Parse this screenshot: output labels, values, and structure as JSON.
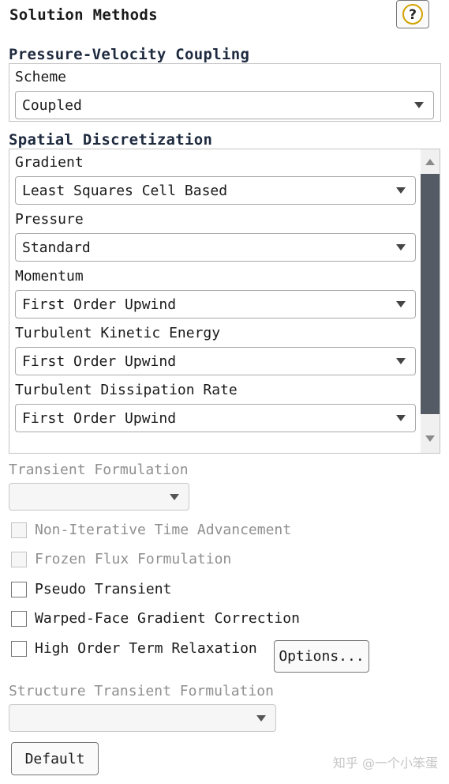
{
  "panel_title": "Solution Methods",
  "help_button_label": "?",
  "pressure_velocity": {
    "section_title": "Pressure-Velocity Coupling",
    "scheme_label": "Scheme",
    "scheme_value": "Coupled"
  },
  "spatial": {
    "section_title": "Spatial Discretization",
    "fields": [
      {
        "label": "Gradient",
        "value": "Least Squares Cell Based"
      },
      {
        "label": "Pressure",
        "value": "Standard"
      },
      {
        "label": "Momentum",
        "value": "First Order Upwind"
      },
      {
        "label": "Turbulent Kinetic Energy",
        "value": "First Order Upwind"
      },
      {
        "label": "Turbulent Dissipation Rate",
        "value": "First Order Upwind"
      }
    ]
  },
  "transient": {
    "label": "Transient Formulation",
    "value": ""
  },
  "checkboxes": [
    {
      "label": "Non-Iterative Time Advancement",
      "enabled": false,
      "checked": false
    },
    {
      "label": "Frozen Flux Formulation",
      "enabled": false,
      "checked": false
    },
    {
      "label": "Pseudo Transient",
      "enabled": true,
      "checked": false
    },
    {
      "label": "Warped-Face Gradient Correction",
      "enabled": true,
      "checked": false
    },
    {
      "label": "High Order Term Relaxation",
      "enabled": true,
      "checked": false
    }
  ],
  "options_button": "Options...",
  "structure_transient": {
    "label": "Structure Transient Formulation",
    "value": ""
  },
  "default_button": "Default",
  "watermark": "知乎 @一个小笨蛋"
}
